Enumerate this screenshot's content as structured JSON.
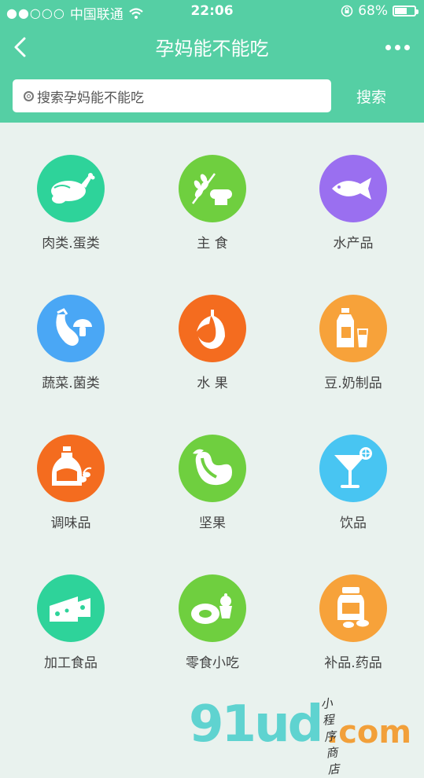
{
  "status_bar": {
    "carrier": "中国联通",
    "time": "22:06",
    "battery": "68%",
    "battery_level": 0.68
  },
  "nav": {
    "title": "孕妈能不能吃"
  },
  "search": {
    "placeholder": "搜索孕妈能不能吃",
    "button": "搜索"
  },
  "categories": [
    {
      "label": "肉类.蛋类",
      "icon": "chicken-icon",
      "color": "#2ed39a"
    },
    {
      "label": "主 食",
      "icon": "grain-bread-icon",
      "color": "#6fcf3f"
    },
    {
      "label": "水产品",
      "icon": "fish-icon",
      "color": "#9a6ff0"
    },
    {
      "label": "蔬菜.菌类",
      "icon": "eggplant-mushroom-icon",
      "color": "#4aa7f5"
    },
    {
      "label": "水 果",
      "icon": "banana-icon",
      "color": "#f46c1f"
    },
    {
      "label": "豆.奶制品",
      "icon": "milk-icon",
      "color": "#f7a23a"
    },
    {
      "label": "调味品",
      "icon": "oil-bottle-icon",
      "color": "#f46c1f"
    },
    {
      "label": "坚果",
      "icon": "nut-icon",
      "color": "#6fcf3f"
    },
    {
      "label": "饮品",
      "icon": "cocktail-icon",
      "color": "#48c5f2"
    },
    {
      "label": "加工食品",
      "icon": "cheese-icon",
      "color": "#2ed39a"
    },
    {
      "label": "零食小吃",
      "icon": "snack-icon",
      "color": "#6fcf3f"
    },
    {
      "label": "补品.药品",
      "icon": "pill-jar-icon",
      "color": "#f7a23a"
    }
  ],
  "watermark": {
    "brand": "91ud",
    "domain": ".com",
    "tagline": "小程序商店"
  }
}
